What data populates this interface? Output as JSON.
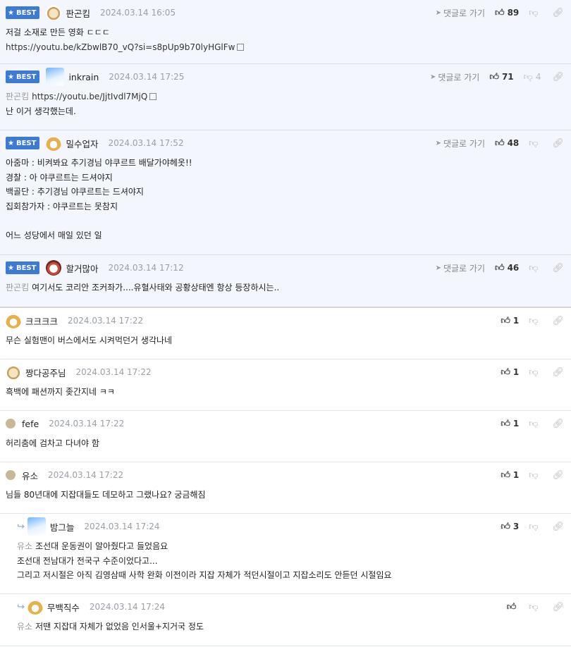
{
  "labels": {
    "best": "BEST",
    "reply_to": "댓글로 가기"
  },
  "comments": [
    {
      "name": "판곤킴",
      "date": "2024.03.14 16:05",
      "up": "89",
      "down": "",
      "lines": [
        "저걸 소재로 만든 영화 ㄷㄷㄷ"
      ],
      "url": "https://youtu.be/kZbwlB70_vQ?si=s8pUp9b70lyHGlFw"
    },
    {
      "name": "inkrain",
      "date": "2024.03.14 17:25",
      "up": "71",
      "down": "4",
      "mention": "판곤킴",
      "url": "https://youtu.be/JjtIvdl7MjQ",
      "lines": [
        "난 이거 생각했는데."
      ]
    },
    {
      "name": "밀수업자",
      "date": "2024.03.14 17:52",
      "up": "48",
      "down": "",
      "lines": [
        "아줌마 : 비켜봐요 추기경님 야쿠르트 배달가야헤옷!!",
        "경찰 : 아 야쿠르트는 드셔야지",
        "백골단 : 추기경님 야쿠르트는 드셔야지",
        "집회참가자 : 야쿠르트는 못참지",
        "",
        "어느 성당에서 매일 있던 일"
      ]
    },
    {
      "name": "할거많아",
      "date": "2024.03.14 17:12",
      "up": "46",
      "down": "",
      "mention": "판곤킴",
      "lines": [
        "여기서도 코리안 조커좌가....유혈사태와 공황상태엔 항상 등장하시는.."
      ]
    },
    {
      "name": "크크크크",
      "date": "2024.03.14 17:22",
      "up": "1",
      "lines": [
        "무슨 실험맨이 버스에서도 시켜먹던거 생각나네"
      ]
    },
    {
      "name": "짱다공주님",
      "date": "2024.03.14 17:22",
      "up": "1",
      "lines": [
        "흑백에 패션까지 좆간지네 ㅋㅋ"
      ]
    },
    {
      "name": "fefe",
      "date": "2024.03.14 17:22",
      "up": "1",
      "lines": [
        "허리춤에 검차고 다녀야 함"
      ]
    },
    {
      "name": "유소",
      "date": "2024.03.14 17:22",
      "up": "1",
      "lines": [
        "님들 80년대에 지잡대들도 데모하고 그랬나요? 궁금해짐"
      ]
    },
    {
      "name": "밤그늘",
      "date": "2024.03.14 17:24",
      "up": "3",
      "mention": "유소",
      "lines": [
        "조선대 운동권이 알아줬다고 들었음요",
        "조선대 전남대가 전국구 수준이었다고...",
        "그리고 저시절은 아직 김영삼때 사학 완화 이전이라 지잡 자체가 적던시절이고 지잡소리도 안듣던 시절임요"
      ]
    },
    {
      "name": "무백직수",
      "date": "2024.03.14 17:24",
      "up": "",
      "mention": "유소",
      "lines": [
        "저땐 지잡대 자체가 없었음 인서울+지거국 정도"
      ]
    }
  ]
}
